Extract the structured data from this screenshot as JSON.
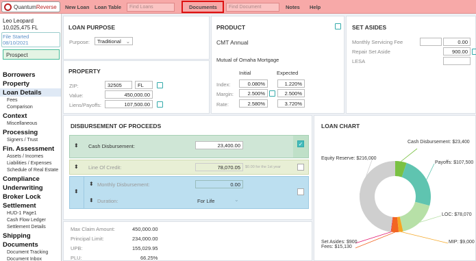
{
  "brand": {
    "name_part1": "Quantum",
    "name_part2": "Reverse"
  },
  "topnav": {
    "new_loan": "New Loan",
    "loan_table": "Loan Table",
    "find_loans_placeholder": "Find Loans",
    "documents": "Documents",
    "find_document_placeholder": "Find Document",
    "notes": "Notes",
    "help": "Help"
  },
  "sidebar": {
    "borrower_name": "Leo Leopard",
    "loan_info": "10,025,475  FL",
    "file_started_label": "File Started",
    "file_started_date": "08/10/2021",
    "status": "Prospect",
    "sections": [
      {
        "label": "Borrowers",
        "items": []
      },
      {
        "label": "Property",
        "items": []
      },
      {
        "label": "Loan Details",
        "items": [
          "Fees",
          "Comparison"
        ]
      },
      {
        "label": "Context",
        "items": [
          "Miscellaneous"
        ]
      },
      {
        "label": "Processing",
        "items": [
          "Signers / Trust"
        ]
      },
      {
        "label": "Fin. Assessment",
        "items": [
          "Assets / Incomes",
          "Liabilities / Expenses",
          "Schedule of Real Estate"
        ]
      },
      {
        "label": "Compliance",
        "items": []
      },
      {
        "label": "Underwriting",
        "items": []
      },
      {
        "label": "Broker Lock",
        "items": []
      },
      {
        "label": "Settlement",
        "items": [
          "HUD-1 Page1",
          "Cash Flow Ledger",
          "Settlement Details"
        ]
      },
      {
        "label": "Shipping",
        "items": []
      },
      {
        "label": "Documents",
        "items": [
          "Document Tracking",
          "Document Inbox"
        ]
      }
    ]
  },
  "loan_purpose": {
    "title": "LOAN PURPOSE",
    "purpose_label": "Purpose:",
    "purpose_value": "Traditional"
  },
  "property": {
    "title": "PROPERTY",
    "zip_label": "ZIP:",
    "zip_value": "32505",
    "state_value": "FL",
    "value_label": "Value:",
    "value_value": "450,000.00",
    "liens_label": "Liens/Payoffs:",
    "liens_value": "107,500.00"
  },
  "product": {
    "title": "PRODUCT",
    "name": "CMT Annual",
    "lender": "Mutual of Omaha Mortgage",
    "col_initial": "Initial",
    "col_expected": "Expected",
    "rows": [
      {
        "label": "Index:",
        "initial": "0.080%",
        "expected": "1.220%"
      },
      {
        "label": "Margin:",
        "initial": "2.500%",
        "expected": "2.500%"
      },
      {
        "label": "Rate:",
        "initial": "2.580%",
        "expected": "3.720%"
      }
    ]
  },
  "set_asides": {
    "title": "SET ASIDES",
    "monthly_servicing_label": "Monthly Servicing Fee",
    "monthly_servicing_value": "0.00",
    "repair_label": "Repair Set Aside",
    "repair_value": "900.00",
    "lesa_label": "LESA"
  },
  "disbursement": {
    "title": "DISBURSEMENT OF PROCEEDS",
    "cash_label": "Cash Disbursement:",
    "cash_value": "23,400.00",
    "loc_label": "Line Of Credit:",
    "loc_value": "78,070.05",
    "loc_note": "$0.00 for the 1st year",
    "monthly_label": "Monthly Disbursement:",
    "monthly_value": "0.00",
    "duration_label": "Duration:",
    "duration_value": "For Life"
  },
  "summary": {
    "max_claim_label": "Max Claim Amount:",
    "max_claim_value": "450,000.00",
    "principal_label": "Principal Limit:",
    "principal_value": "234,000.00",
    "upb_label": "UPB:",
    "upb_value": "155,029.95",
    "plu_label": "PLU:",
    "plu_value": "66.25%"
  },
  "loan_chart": {
    "title": "LOAN CHART"
  },
  "chart_data": {
    "type": "pie",
    "title": "LOAN CHART",
    "slices": [
      {
        "label": "Cash Disbursement",
        "text": "Cash Disbursement: $23,400",
        "value": 23400,
        "color": "#7ac143"
      },
      {
        "label": "Payoffs",
        "text": "Payoffs: $107,500",
        "value": 107500,
        "color": "#5fc4b0"
      },
      {
        "label": "LOC",
        "text": "LOC: $78,070",
        "value": 78070,
        "color": "#b7e0a7"
      },
      {
        "label": "MIP",
        "text": "MIP: $9,000",
        "value": 9000,
        "color": "#f5a623"
      },
      {
        "label": "Fees",
        "text": "Fees: $15,130",
        "value": 15130,
        "color": "#f26522"
      },
      {
        "label": "Set Asides",
        "text": "Set Asides: $900",
        "value": 900,
        "color": "#e2136e"
      },
      {
        "label": "Equity Reserve",
        "text": "Equity Reserve: $216,000",
        "value": 216000,
        "color": "#cfcfcf"
      }
    ]
  }
}
